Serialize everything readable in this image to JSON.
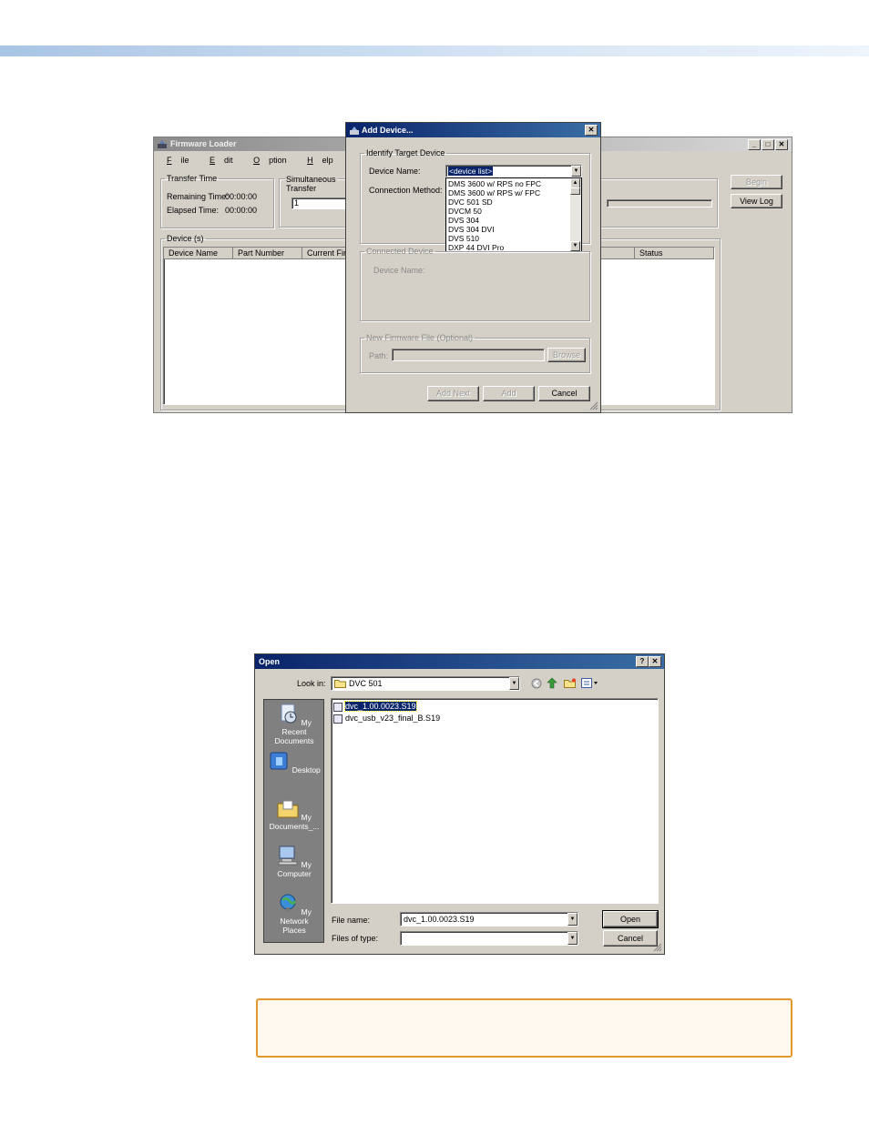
{
  "firmware_loader": {
    "title": "Firmware Loader",
    "menu": [
      {
        "label": "File",
        "mnemonic": "F",
        "rest": "ile"
      },
      {
        "label": "Edit",
        "mnemonic": "E",
        "rest": "dit"
      },
      {
        "label": "Option",
        "mnemonic": "O",
        "rest": "ption"
      },
      {
        "label": "Help",
        "mnemonic": "H",
        "rest": "elp"
      }
    ],
    "transfer_time": {
      "legend": "Transfer Time",
      "remaining_label": "Remaining Time:",
      "remaining_value": "00:00:00",
      "elapsed_label": "Elapsed Time:",
      "elapsed_value": "00:00:00"
    },
    "simultaneous": {
      "legend_line1": "Simultaneous",
      "legend_line2": "Transfer",
      "value": "1"
    },
    "buttons": {
      "begin": "Begin",
      "view_log": "View Log"
    },
    "devices": {
      "legend": "Device (s)",
      "columns": [
        "Device Name",
        "Part Number",
        "Current Firm",
        "Status"
      ]
    },
    "caption_buttons": {
      "minimize": "_",
      "maximize": "□",
      "close": "✕"
    }
  },
  "add_device": {
    "title": "Add Device...",
    "identify": {
      "legend": "Identify Target Device",
      "device_name_label": "Device Name:",
      "connection_method_label": "Connection Method:",
      "selected": "<device list>",
      "list": [
        "DMS 3600 w/ RPS no FPC",
        "DMS 3600 w/ RPS w/ FPC",
        "DVC 501 SD",
        "DVCM 50",
        "DVS 304",
        "DVS 304 DVI",
        "DVS 510",
        "DXP 44 DVI Pro"
      ]
    },
    "connected": {
      "legend": "Connected Device",
      "device_name_label": "Device Name:"
    },
    "firmware": {
      "legend": "New Firmware File (Optional)",
      "path_label": "Path:",
      "browse": "Browse"
    },
    "buttons": {
      "add_next": "Add Next",
      "add": "Add",
      "cancel": "Cancel"
    },
    "close": "✕"
  },
  "open_dialog": {
    "title": "Open",
    "help": "?",
    "close": "✕",
    "look_in_label": "Look in:",
    "look_in_value": "DVC 501",
    "places": [
      {
        "line1": "My Recent",
        "line2": "Documents",
        "icon": "recent-documents-icon"
      },
      {
        "line1": "Desktop",
        "line2": "",
        "icon": "desktop-icon"
      },
      {
        "line1": "My",
        "line2": "Documents_...",
        "icon": "my-documents-icon"
      },
      {
        "line1": "My Computer",
        "line2": "",
        "icon": "my-computer-icon"
      },
      {
        "line1": "My Network",
        "line2": "Places",
        "icon": "network-places-icon"
      }
    ],
    "files": [
      {
        "name": "dvc_1.00.0023.S19",
        "selected": true
      },
      {
        "name": "dvc_usb_v23_final_B.S19",
        "selected": false
      }
    ],
    "file_name_label": "File name:",
    "file_name_value": "dvc_1.00.0023.S19",
    "file_type_label": "Files of type:",
    "file_type_value": "",
    "buttons": {
      "open": "Open",
      "cancel": "Cancel"
    }
  },
  "colors": {
    "accent_title": "#0a246a",
    "note_border": "#e0992a",
    "window_face": "#d4d0c8"
  }
}
